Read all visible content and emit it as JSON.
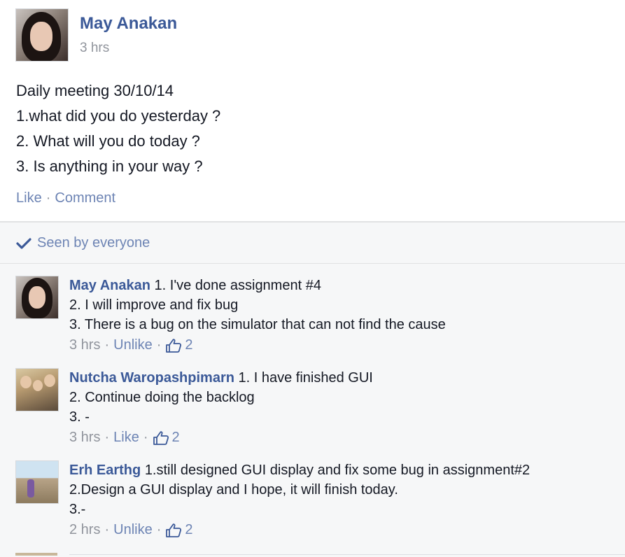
{
  "post": {
    "author": "May Anakan",
    "time": "3 hrs",
    "lines": [
      "Daily meeting 30/10/14",
      "1.what did you do yesterday ?",
      "2. What will you do today ?",
      "3. Is anything in your way ?"
    ],
    "actions": {
      "like": "Like",
      "separator": "·",
      "comment": "Comment"
    }
  },
  "seen": {
    "label": "Seen by everyone",
    "icon": "checkmark-icon"
  },
  "comments": [
    {
      "name": "May Anakan",
      "first_line": "1. I've done assignment #4",
      "lines": [
        "2. I will improve and fix bug",
        "3. There is a bug on the simulator that can not find the cause"
      ],
      "time": "3 hrs",
      "action": "Unlike",
      "likes": "2"
    },
    {
      "name": "Nutcha Waropashpimarn",
      "first_line": "1. I have finished GUI",
      "lines": [
        "2. Continue doing the backlog",
        "3. -"
      ],
      "time": "3 hrs",
      "action": "Like",
      "likes": "2"
    },
    {
      "name": "Erh Earthg",
      "first_line": "1.still designed GUI display and fix some bug in assignment#2",
      "lines": [
        "2.Design a GUI display and I hope, it will finish today.",
        "3.-"
      ],
      "time": "2 hrs",
      "action": "Unlike",
      "likes": "2"
    }
  ],
  "colors": {
    "link": "#3b5998",
    "muted_link": "#6d84b4",
    "meta": "#90949c",
    "feedback_bg": "#f6f7f8"
  }
}
